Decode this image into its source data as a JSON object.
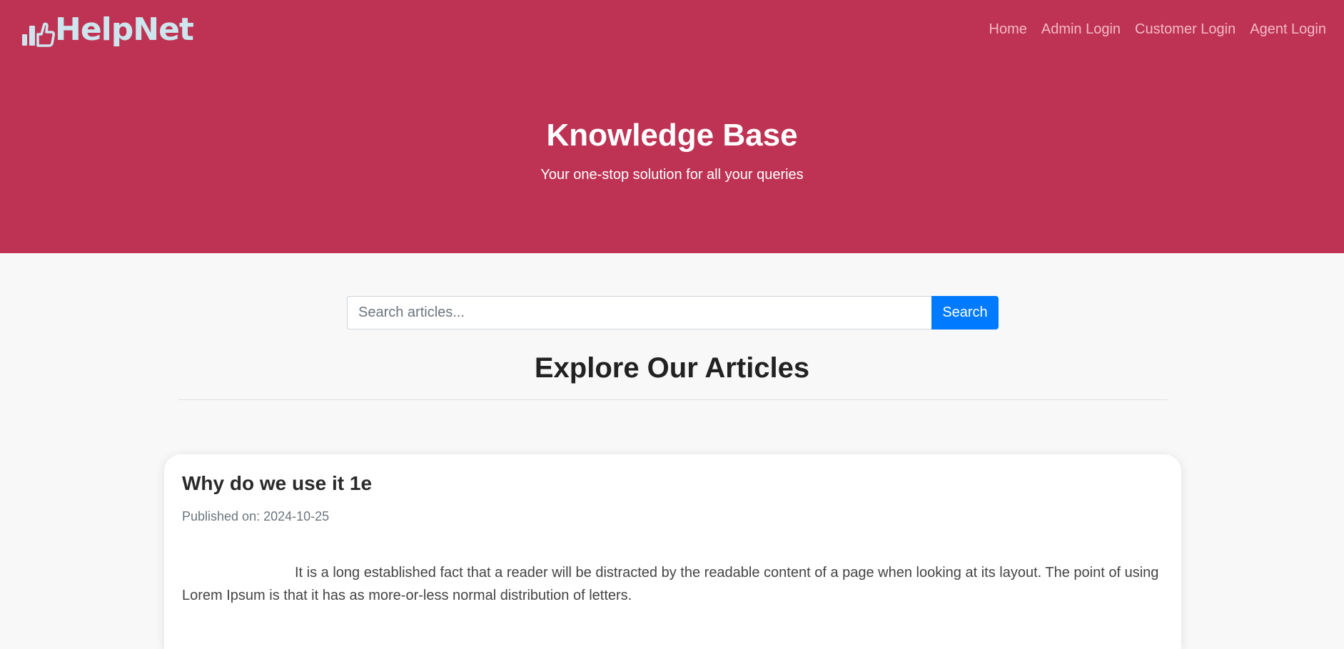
{
  "brand": {
    "name": "HelpNet",
    "logo_text": "HelpNet"
  },
  "nav": {
    "items": [
      {
        "label": "Home"
      },
      {
        "label": "Admin Login"
      },
      {
        "label": "Customer Login"
      },
      {
        "label": "Agent Login"
      }
    ]
  },
  "hero": {
    "title": "Knowledge Base",
    "subtitle": "Your one-stop solution for all your queries"
  },
  "search": {
    "placeholder": "Search articles...",
    "value": "",
    "button_label": "Search"
  },
  "articles_section": {
    "title": "Explore Our Articles",
    "articles": [
      {
        "title": "Why do we use it 1e",
        "published": "Published on: 2024-10-25",
        "body": "It is a long established fact that a reader will be distracted by the readable content of a page when looking at its layout. The point of using Lorem Ipsum is that it has as more-or-less normal distribution of letters."
      }
    ]
  },
  "colors": {
    "hero_bg": "#be3353",
    "nav_link": "#f3b9c7",
    "logo": "#cde6ee",
    "search_button": "#007bff",
    "page_bg": "#f8f8f8"
  },
  "icons": {
    "logo_mark": "bar-chart-thumbs-up-icon"
  }
}
